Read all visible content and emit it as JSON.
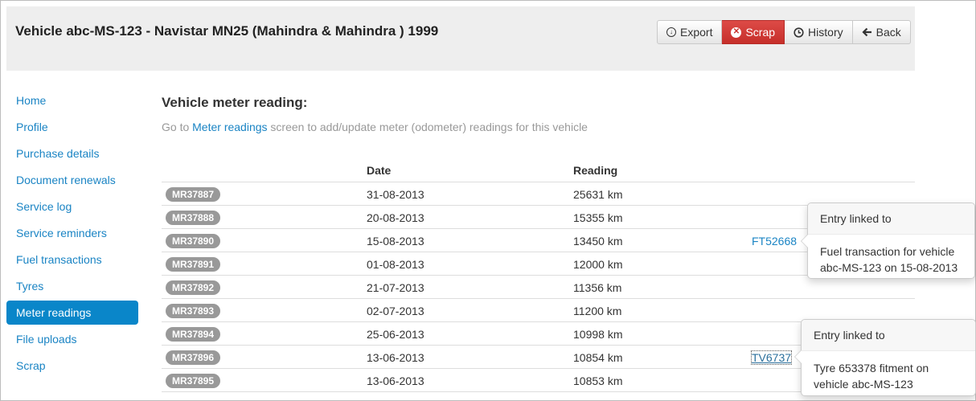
{
  "header": {
    "title": "Vehicle abc-MS-123 - Navistar MN25 (Mahindra & Mahindra ) 1999",
    "buttons": {
      "export": "Export",
      "scrap": "Scrap",
      "history": "History",
      "back": "Back"
    }
  },
  "sidebar": {
    "items": [
      {
        "label": "Home"
      },
      {
        "label": "Profile"
      },
      {
        "label": "Purchase details"
      },
      {
        "label": "Document renewals"
      },
      {
        "label": "Service log"
      },
      {
        "label": "Service reminders"
      },
      {
        "label": "Fuel transactions"
      },
      {
        "label": "Tyres"
      },
      {
        "label": "Meter readings",
        "active": true
      },
      {
        "label": "File uploads"
      },
      {
        "label": "Scrap"
      }
    ]
  },
  "main": {
    "title": "Vehicle meter reading:",
    "hint_prefix": "Go to ",
    "hint_link": "Meter readings",
    "hint_suffix": " screen to add/update meter (odometer) readings for this vehicle",
    "columns": {
      "date": "Date",
      "reading": "Reading"
    },
    "rows": [
      {
        "id": "MR37887",
        "date": "31-08-2013",
        "reading": "25631 km",
        "link": ""
      },
      {
        "id": "MR37888",
        "date": "20-08-2013",
        "reading": "15355 km",
        "link": ""
      },
      {
        "id": "MR37890",
        "date": "15-08-2013",
        "reading": "13450 km",
        "link": "FT52668"
      },
      {
        "id": "MR37891",
        "date": "01-08-2013",
        "reading": "12000 km",
        "link": ""
      },
      {
        "id": "MR37892",
        "date": "21-07-2013",
        "reading": "11356 km",
        "link": ""
      },
      {
        "id": "MR37893",
        "date": "02-07-2013",
        "reading": "11200 km",
        "link": ""
      },
      {
        "id": "MR37894",
        "date": "25-06-2013",
        "reading": "10998 km",
        "link": ""
      },
      {
        "id": "MR37896",
        "date": "13-06-2013",
        "reading": "10854 km",
        "link": "TV6737"
      },
      {
        "id": "MR37895",
        "date": "13-06-2013",
        "reading": "10853 km",
        "link": ""
      }
    ]
  },
  "popovers": {
    "fuel": {
      "title": "Entry linked to",
      "body": "Fuel transaction for vehicle abc-MS-123 on 15-08-2013"
    },
    "tyre": {
      "title": "Entry linked to",
      "body": "Tyre 653378 fitment on vehicle abc-MS-123"
    }
  },
  "colors": {
    "primary": "#0a86c9",
    "danger": "#c9302c",
    "link": "#1a84c4",
    "badge": "#999999"
  },
  "icons": {
    "export": "circle-arrow-down-icon",
    "scrap": "circle-x-icon",
    "history": "clock-icon",
    "back": "arrow-left-icon"
  }
}
